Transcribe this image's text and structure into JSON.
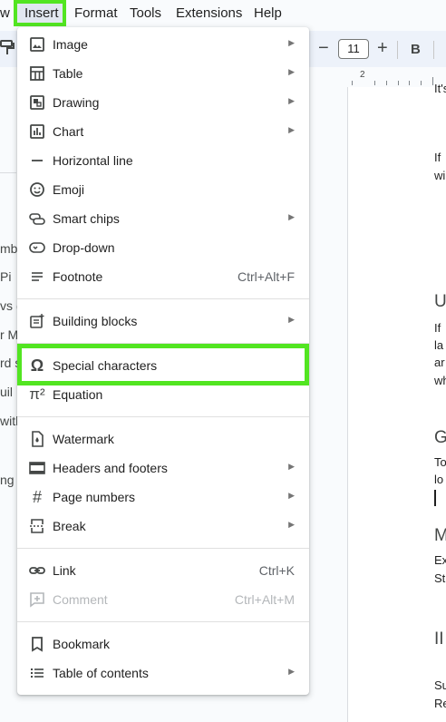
{
  "menubar": {
    "partial_left": "w",
    "items": [
      "Insert",
      "Format",
      "Tools",
      "Extensions",
      "Help"
    ]
  },
  "toolbar": {
    "font_size": "11",
    "minus": "−",
    "plus": "+",
    "bold": "B"
  },
  "ruler": {
    "number": "2"
  },
  "insert_menu": {
    "items": [
      {
        "label": "Image",
        "icon": "image-icon",
        "submenu": true
      },
      {
        "label": "Table",
        "icon": "table-icon",
        "submenu": true
      },
      {
        "label": "Drawing",
        "icon": "drawing-icon",
        "submenu": true
      },
      {
        "label": "Chart",
        "icon": "chart-icon",
        "submenu": true
      },
      {
        "label": "Horizontal line",
        "icon": "horizontal-line-icon"
      },
      {
        "label": "Emoji",
        "icon": "emoji-icon"
      },
      {
        "label": "Smart chips",
        "icon": "smart-chips-icon",
        "submenu": true
      },
      {
        "label": "Drop-down",
        "icon": "dropdown-icon"
      },
      {
        "label": "Footnote",
        "icon": "footnote-icon",
        "shortcut": "Ctrl+Alt+F"
      },
      {
        "label": "Building blocks",
        "icon": "building-blocks-icon",
        "submenu": true
      },
      {
        "label": "Special characters",
        "icon": "omega-icon",
        "highlighted": true
      },
      {
        "label": "Equation",
        "icon": "pi-icon"
      },
      {
        "label": "Watermark",
        "icon": "watermark-icon"
      },
      {
        "label": "Headers and footers",
        "icon": "headers-footers-icon",
        "submenu": true
      },
      {
        "label": "Page numbers",
        "icon": "hash-icon",
        "submenu": true
      },
      {
        "label": "Break",
        "icon": "break-icon",
        "submenu": true
      },
      {
        "label": "Link",
        "icon": "link-icon",
        "shortcut": "Ctrl+K"
      },
      {
        "label": "Comment",
        "icon": "comment-icon",
        "shortcut": "Ctrl+Alt+M",
        "disabled": true
      },
      {
        "label": "Bookmark",
        "icon": "bookmark-icon"
      },
      {
        "label": "Table of contents",
        "icon": "toc-icon",
        "submenu": true
      }
    ]
  },
  "outline_fragments": [
    "mbe",
    "Pi",
    "vs (",
    "r M",
    "rd s",
    "uil",
    "with",
    "ng"
  ],
  "document_fragments": {
    "lines": [
      "It's",
      "If",
      "wi",
      "If",
      "la",
      "ar",
      "wh",
      "To",
      "lo",
      "Ex",
      "St",
      "Su",
      "Re"
    ],
    "headings": [
      "U",
      "G",
      "M",
      "II"
    ]
  },
  "colors": {
    "highlight": "#52e521",
    "menu_bg": "#ffffff",
    "page_bg": "#f9fbfd",
    "toolbar_bg": "#edf2fa"
  }
}
